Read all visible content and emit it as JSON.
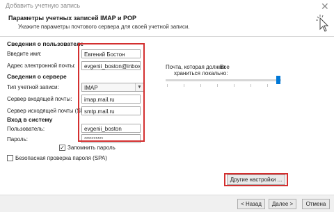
{
  "window": {
    "title": "Добавить учетную запись"
  },
  "header": {
    "title": "Параметры учетных записей IMAP и POP",
    "subtitle": "Укажите параметры почтового сервера для своей учетной записи."
  },
  "user_info": {
    "heading": "Сведения о пользователе",
    "name_label": "Введите имя:",
    "name_value": "Евгений Бостон",
    "email_label": "Адрес электронной почты:",
    "email_value": "evgenii_boston@inbox.ru"
  },
  "server_info": {
    "heading": "Сведения о сервере",
    "type_label": "Тип учетной записи:",
    "type_value": "IMAP",
    "incoming_label": "Сервер входящей почты:",
    "incoming_value": "imap.mail.ru",
    "outgoing_label": "Сервер исходящей почты (SMTP):",
    "outgoing_value": "smtp.mail.ru"
  },
  "login_info": {
    "heading": "Вход в систему",
    "user_label": "Пользователь:",
    "user_value": "evgenii_boston",
    "password_label": "Пароль:",
    "password_value": "**********",
    "remember_label": "Запомнить пароль",
    "remember_checked": true,
    "spa_label": "Безопасная проверка пароля (SPA)",
    "spa_checked": false
  },
  "offline": {
    "label_line1": "Почта, которая должна",
    "label_line2": "храниться локально:",
    "value_label": "Все",
    "level": 1.0
  },
  "buttons": {
    "more_settings": "Другие настройки ...",
    "back": "< Назад",
    "next": "Далее >",
    "cancel": "Отмена"
  },
  "colors": {
    "highlight": "#d32f2f",
    "slider_thumb": "#0078d7"
  }
}
